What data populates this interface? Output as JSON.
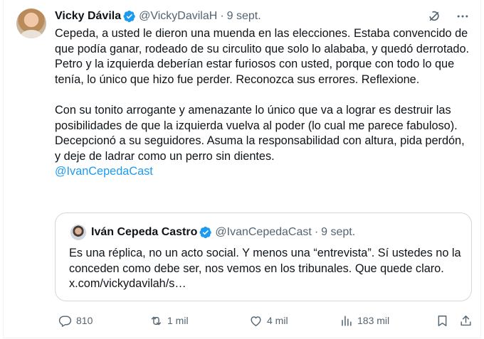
{
  "tweet": {
    "author_name": "Vicky Dávila",
    "author_handle": "@VickyDavilaH",
    "separator": "·",
    "date": "9 sept.",
    "paragraph1": "Cepeda, a usted le dieron una muenda en las elecciones. Estaba convencido de que podía ganar, rodeado de su circulito que solo lo alababa, y quedó derrotado. Petro y la izquierda deberían estar furiosos con usted, porque con todo lo que tenía, lo único que hizo fue perder. Reconozca sus errores. Reflexione.",
    "paragraph2": "Con su tonito arrogante y amenazante lo único que va a lograr es destruir las posibilidades de que la izquierda vuelva al poder (lo cual me parece fabuloso). Decepcionó a su seguidores. Asuma la responsabilidad con altura, pida perdón, y deje de ladrar como un perro sin dientes.",
    "mention": "@IvanCepedaCast"
  },
  "quote": {
    "author_name": "Iván Cepeda Castro",
    "author_handle": "@IvanCepedaCast",
    "separator": "·",
    "date": "9 sept.",
    "text": "Es una réplica, no un acto social. Y menos una “entrevista”. Sí ustedes no la conceden como debe ser, nos vemos en los tribunales. Que quede claro. x.com/vickydavilah/s…"
  },
  "actions": {
    "replies": "810",
    "reposts": "1 mil",
    "likes": "4 mil",
    "views": "183 mil"
  },
  "colors": {
    "verified_blue": "#1d9bf0",
    "muted_text": "#536471",
    "link": "#1d9bf0",
    "border": "#cfd9de"
  },
  "icons": [
    "grok-icon",
    "more-icon",
    "verified-badge-icon",
    "reply-icon",
    "repost-icon",
    "like-icon",
    "views-icon",
    "bookmark-icon",
    "share-icon"
  ]
}
